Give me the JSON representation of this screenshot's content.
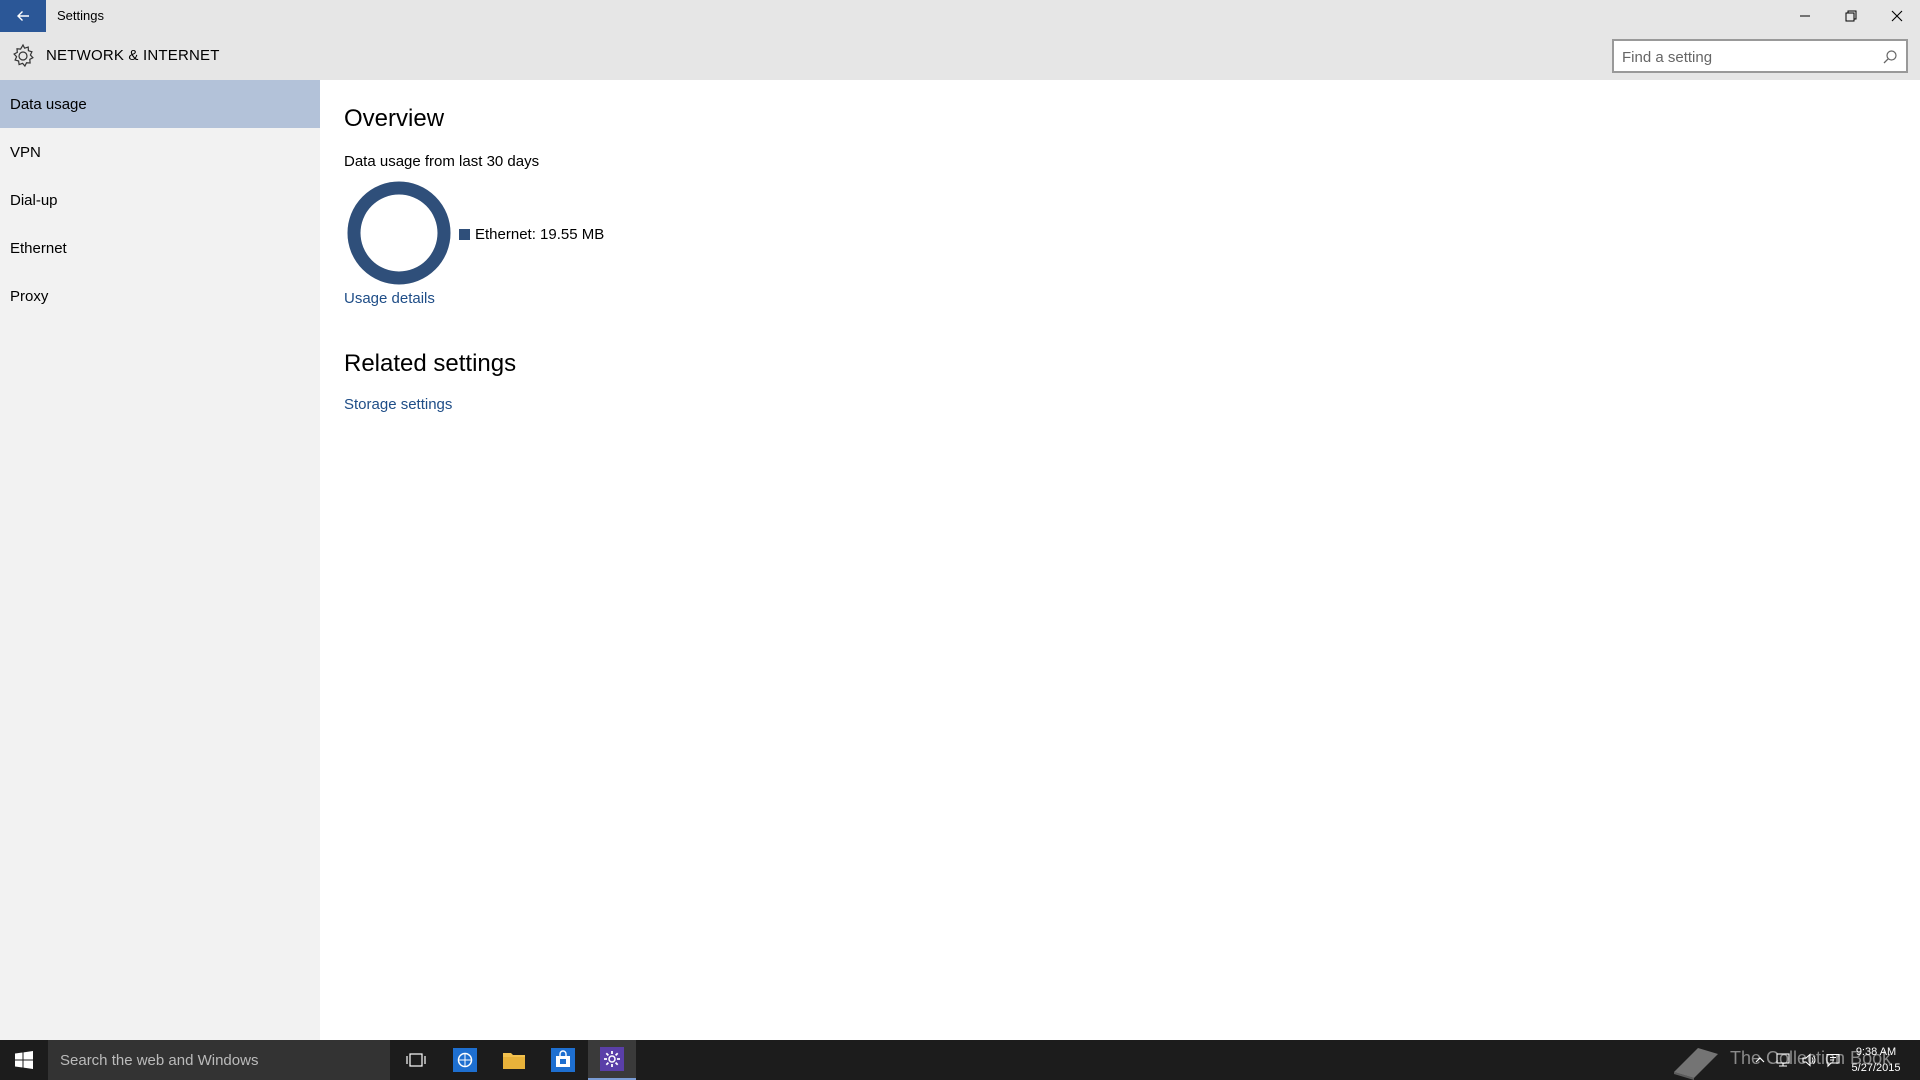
{
  "window": {
    "title": "Settings"
  },
  "header": {
    "section_title": "NETWORK & INTERNET",
    "search_placeholder": "Find a setting"
  },
  "sidebar": {
    "items": [
      {
        "label": "Data usage",
        "active": true
      },
      {
        "label": "VPN",
        "active": false
      },
      {
        "label": "Dial-up",
        "active": false
      },
      {
        "label": "Ethernet",
        "active": false
      },
      {
        "label": "Proxy",
        "active": false
      }
    ]
  },
  "main": {
    "overview_heading": "Overview",
    "usage_period_label": "Data usage from last 30 days",
    "chart": {
      "legend_label": "Ethernet: 19.55 MB",
      "share": 1.0,
      "color": "#2f4f7a"
    },
    "usage_details_link": "Usage details",
    "related_heading": "Related settings",
    "storage_link": "Storage settings"
  },
  "taskbar": {
    "search_placeholder": "Search the web and Windows",
    "apps": [
      "task-view",
      "internet-explorer",
      "file-explorer",
      "store",
      "settings"
    ],
    "watermark": "The Collection Book",
    "time": "9:38 AM",
    "date": "5/27/2015"
  },
  "colors": {
    "accent": "#2b5797",
    "active_nav": "#b3c2d9",
    "link": "#1e4d87",
    "chrome_bg": "#e6e6e6",
    "sidebar_bg": "#f2f2f2",
    "taskbar_bg": "#1c1c1c"
  }
}
